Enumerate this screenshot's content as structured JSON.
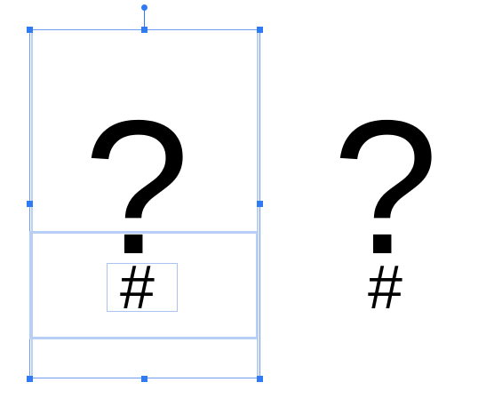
{
  "canvas": {
    "selected_group": {
      "question_glyph": "?",
      "hash_glyph": "#"
    },
    "unselected_group": {
      "question_glyph": "?",
      "hash_glyph": "#"
    }
  },
  "colors": {
    "selection_accent": "#2f7bf5",
    "selection_frame": "#6f9cf0",
    "child_frame": "#b7cff6",
    "glyph": "#000000"
  },
  "icons": {
    "rotate_handle": "rotate-handle-icon",
    "resize_handle": "resize-handle-icon"
  }
}
